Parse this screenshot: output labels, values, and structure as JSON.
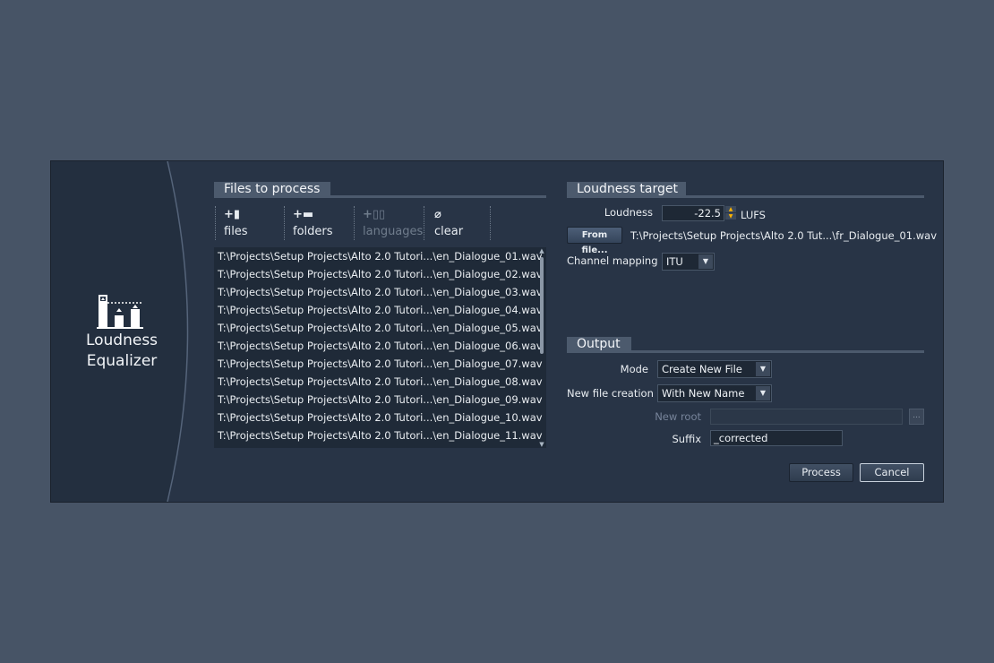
{
  "app": {
    "name_line1": "Loudness",
    "name_line2": "Equalizer"
  },
  "files_section": {
    "title": "Files to process",
    "toolbar": [
      {
        "icon": "+▮",
        "label": "files",
        "enabled": true,
        "icon_name": "add-file-icon"
      },
      {
        "icon": "+▬",
        "label": "folders",
        "enabled": true,
        "icon_name": "add-folder-icon"
      },
      {
        "icon": "+▯▯",
        "label": "languages",
        "enabled": false,
        "icon_name": "add-languages-icon"
      },
      {
        "icon": "⌀",
        "label": "clear",
        "enabled": true,
        "icon_name": "clear-icon"
      }
    ],
    "files": [
      "T:\\Projects\\Setup Projects\\Alto 2.0 Tutori...\\en_Dialogue_01.wav",
      "T:\\Projects\\Setup Projects\\Alto 2.0 Tutori...\\en_Dialogue_02.wav",
      "T:\\Projects\\Setup Projects\\Alto 2.0 Tutori...\\en_Dialogue_03.wav",
      "T:\\Projects\\Setup Projects\\Alto 2.0 Tutori...\\en_Dialogue_04.wav",
      "T:\\Projects\\Setup Projects\\Alto 2.0 Tutori...\\en_Dialogue_05.wav",
      "T:\\Projects\\Setup Projects\\Alto 2.0 Tutori...\\en_Dialogue_06.wav",
      "T:\\Projects\\Setup Projects\\Alto 2.0 Tutori...\\en_Dialogue_07.wav",
      "T:\\Projects\\Setup Projects\\Alto 2.0 Tutori...\\en_Dialogue_08.wav",
      "T:\\Projects\\Setup Projects\\Alto 2.0 Tutori...\\en_Dialogue_09.wav",
      "T:\\Projects\\Setup Projects\\Alto 2.0 Tutori...\\en_Dialogue_10.wav",
      "T:\\Projects\\Setup Projects\\Alto 2.0 Tutori...\\en_Dialogue_11.wav"
    ]
  },
  "loudness_section": {
    "title": "Loudness target",
    "loudness_label": "Loudness",
    "loudness_value": "-22.5",
    "unit": "LUFS",
    "from_file_button": "From file...",
    "from_file_path": "T:\\Projects\\Setup Projects\\Alto 2.0 Tut...\\fr_Dialogue_01.wav",
    "channel_mapping_label": "Channel mapping",
    "channel_mapping_value": "ITU"
  },
  "output_section": {
    "title": "Output",
    "mode_label": "Mode",
    "mode_value": "Create New File",
    "new_file_creation_label": "New file creation",
    "new_file_creation_value": "With New Name",
    "new_root_label": "New root",
    "new_root_value": "",
    "browse_label": "...",
    "suffix_label": "Suffix",
    "suffix_value": "_corrected"
  },
  "buttons": {
    "process": "Process",
    "cancel": "Cancel"
  },
  "colors": {
    "background": "#475466",
    "panel": "#283446",
    "header": "#4c5a6d",
    "spin_accent": "#ffb400"
  }
}
